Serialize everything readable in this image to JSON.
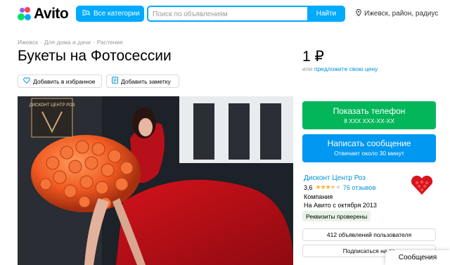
{
  "header": {
    "logo_text": "Avito",
    "categories_label": "Все категории",
    "search_placeholder": "Поиск по объявлениям",
    "search_value": "",
    "find_label": "Найти",
    "location_label": "Ижевск, район, радиус"
  },
  "breadcrumbs": [
    "Ижевск",
    "Для дома и дачи",
    "Растения"
  ],
  "listing": {
    "title": "Букеты на Фотосессии",
    "price": "1 ₽",
    "price_prefix": "или",
    "price_link": "предложите свою цену",
    "favorite_label": "Добавить в избранное",
    "note_label": "Добавить заметку",
    "photo_watermark": "ДИСКОНТ ЦЕНТР РОЗ"
  },
  "actions": {
    "phone_label": "Показать телефон",
    "phone_masked": "8 XXX XXX-XX-XX",
    "message_label": "Написать сообщение",
    "message_sub": "Отвечает около 30 минут"
  },
  "seller": {
    "name": "Дисконт Центр Роз",
    "rating": "3,6",
    "stars_filled": 3.5,
    "stars_total": 5,
    "reviews": "76 отзывов",
    "type": "Компания",
    "since": "На Авито с октября 2013",
    "verified": "Реквизиты проверены",
    "ads_count": "412 объявлений пользователя",
    "subscribe": "Подписаться на пр"
  },
  "messages_tab": "Сообщения",
  "colors": {
    "accent": "#00aaff",
    "phone_button": "#04b65a",
    "message_button": "#0098f0",
    "link": "#0091d9",
    "stars": "#ffb021"
  }
}
